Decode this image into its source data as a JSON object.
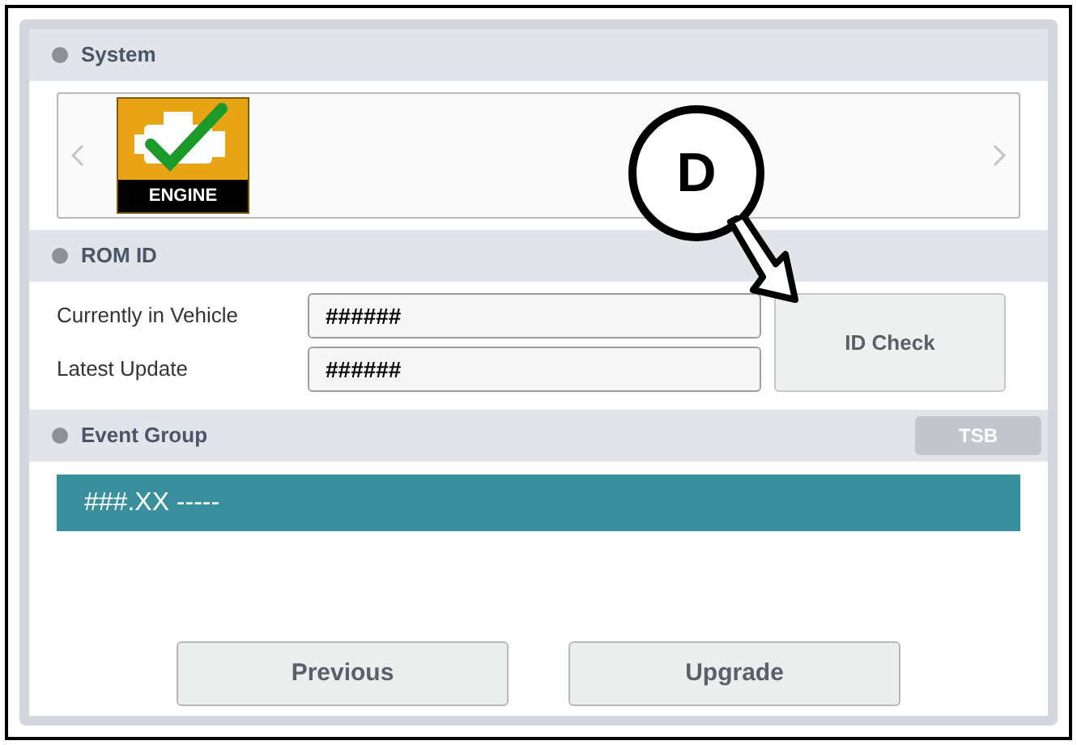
{
  "system": {
    "title": "System",
    "items": [
      {
        "label": "ENGINE",
        "checked": true
      }
    ]
  },
  "rom_id": {
    "title": "ROM ID",
    "fields": [
      {
        "label": "Currently in Vehicle",
        "value": "######"
      },
      {
        "label": "Latest Update",
        "value": "######"
      }
    ],
    "button": "ID Check"
  },
  "event_group": {
    "title": "Event Group",
    "tsb": {
      "label": "TSB",
      "disabled": true
    },
    "rows": [
      {
        "text": "###.XX -----",
        "selected": true
      }
    ]
  },
  "buttons": [
    "Previous",
    "Upgrade"
  ],
  "callout": {
    "label": "D"
  }
}
